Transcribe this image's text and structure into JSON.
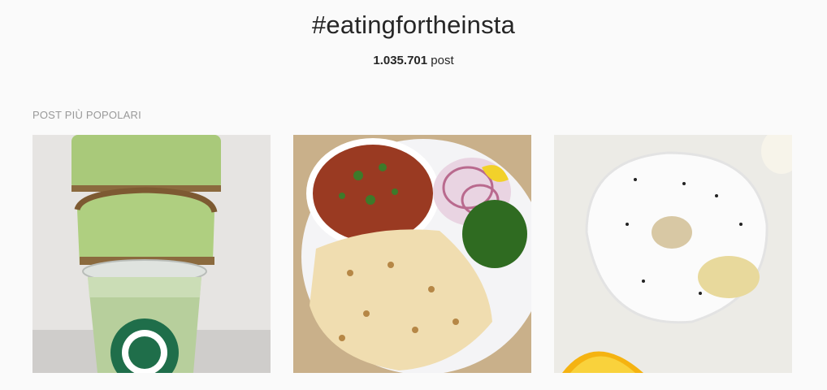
{
  "header": {
    "hashtag": "#eatingfortheinsta",
    "post_count": "1.035.701",
    "post_word": "post"
  },
  "sections": {
    "top_posts_label": "POST PIÙ POPOLARI"
  },
  "posts": [
    {
      "subject": "matcha bread stacked on Starbucks iced matcha latte"
    },
    {
      "subject": "curry bowl with flatbread, onions and green chutney"
    },
    {
      "subject": "glazed lemon poppy seed donut with orange slice"
    }
  ]
}
